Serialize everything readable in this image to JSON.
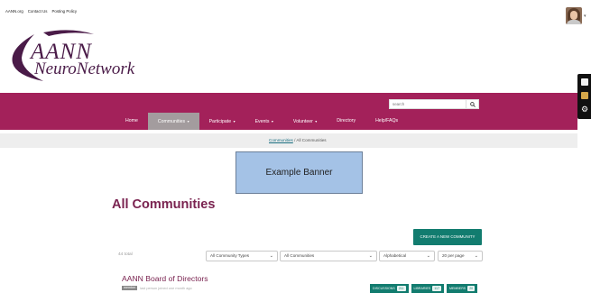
{
  "top_links": [
    {
      "label": "AANN.org"
    },
    {
      "label": "Contact Us"
    },
    {
      "label": "Posting Policy"
    }
  ],
  "logo": {
    "line1": "AANN",
    "line2": "NeuroNetwork",
    "color": "#4a1b48"
  },
  "user": {
    "caret": "▾"
  },
  "side_tools": [
    {
      "icon": "document-icon"
    },
    {
      "icon": "folder-icon"
    },
    {
      "icon": "gear-icon",
      "glyph": "⚙"
    }
  ],
  "search": {
    "placeholder": "search",
    "button_glyph": "🔍"
  },
  "nav": {
    "bg_color": "#a3215a",
    "active_color": "#a39c9e",
    "items": [
      {
        "label": "Home",
        "caret": ""
      },
      {
        "label": "Communities",
        "caret": "▾"
      },
      {
        "label": "Participate",
        "caret": "▾"
      },
      {
        "label": "Events",
        "caret": "▾"
      },
      {
        "label": "Volunteer",
        "caret": "▾"
      },
      {
        "label": "Directory",
        "caret": ""
      },
      {
        "label": "Help/FAQs",
        "caret": ""
      }
    ]
  },
  "breadcrumb": {
    "link": "Communities",
    "separator": "/",
    "current": "All Communities"
  },
  "banner": {
    "text": "Example Banner",
    "color": "#a4c2e6"
  },
  "page": {
    "title": "All Communities"
  },
  "create_button": {
    "label": "CREATE A NEW COMMUNITY",
    "color": "#127c6f"
  },
  "filters": {
    "count_text": "44 total",
    "types": "All Community Types",
    "scope": "All Communities",
    "sort": "Alphabetical",
    "per_page": "20 per page"
  },
  "community": {
    "name": "AANN Board of Directors",
    "badge": "member",
    "meta": "last person joined one month ago",
    "counters": [
      {
        "label": "DISCUSSIONS",
        "value": "211"
      },
      {
        "label": "LIBRARIES",
        "value": "117"
      },
      {
        "label": "MEMBERS",
        "value": "20"
      }
    ]
  }
}
